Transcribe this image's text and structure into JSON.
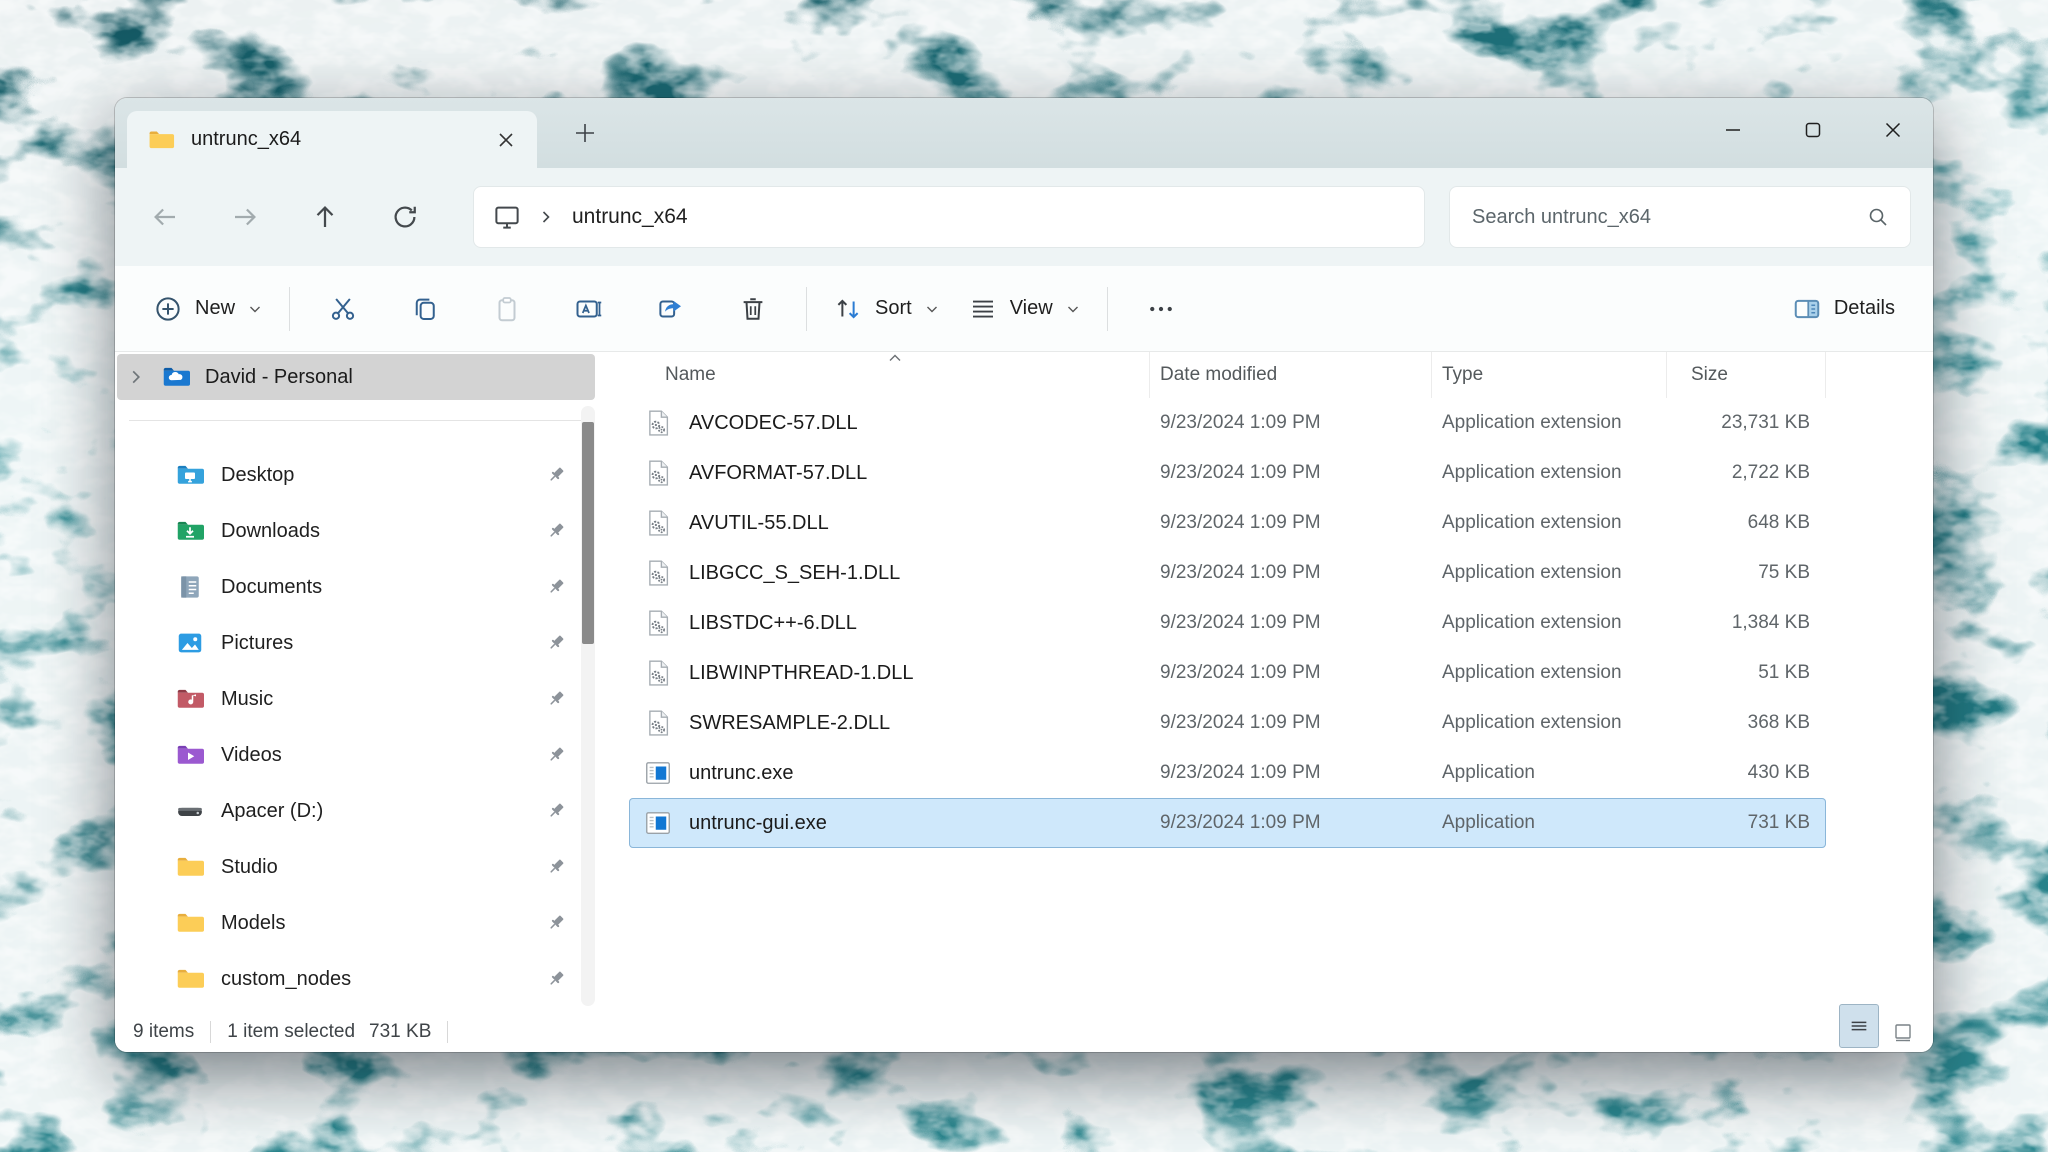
{
  "window": {
    "tab_title": "untrunc_x64",
    "controls": {
      "minimize": "minimize",
      "maximize": "maximize",
      "close": "close"
    }
  },
  "nav": {
    "address": {
      "location": "untrunc_x64"
    },
    "search": {
      "placeholder": "Search untrunc_x64"
    }
  },
  "toolbar": {
    "new_label": "New",
    "sort_label": "Sort",
    "view_label": "View",
    "details_label": "Details"
  },
  "sidebar": {
    "root": {
      "label": "David - Personal",
      "icon": "onedrive-folder"
    },
    "items": [
      {
        "label": "Desktop",
        "icon": "desktop",
        "pinned": true
      },
      {
        "label": "Downloads",
        "icon": "downloads",
        "pinned": true
      },
      {
        "label": "Documents",
        "icon": "documents",
        "pinned": true
      },
      {
        "label": "Pictures",
        "icon": "pictures",
        "pinned": true
      },
      {
        "label": "Music",
        "icon": "music",
        "pinned": true
      },
      {
        "label": "Videos",
        "icon": "videos",
        "pinned": true
      },
      {
        "label": "Apacer (D:)",
        "icon": "drive",
        "pinned": true
      },
      {
        "label": "Studio",
        "icon": "folder",
        "pinned": true
      },
      {
        "label": "Models",
        "icon": "folder",
        "pinned": true
      },
      {
        "label": "custom_nodes",
        "icon": "folder",
        "pinned": true
      }
    ]
  },
  "files": {
    "columns": [
      "Name",
      "Date modified",
      "Type",
      "Size"
    ],
    "sort": {
      "column": "Name",
      "direction": "ascending"
    },
    "rows": [
      {
        "name": "AVCODEC-57.DLL",
        "date": "9/23/2024 1:09 PM",
        "type": "Application extension",
        "size": "23,731 KB",
        "icon": "dll",
        "selected": false
      },
      {
        "name": "AVFORMAT-57.DLL",
        "date": "9/23/2024 1:09 PM",
        "type": "Application extension",
        "size": "2,722 KB",
        "icon": "dll",
        "selected": false
      },
      {
        "name": "AVUTIL-55.DLL",
        "date": "9/23/2024 1:09 PM",
        "type": "Application extension",
        "size": "648 KB",
        "icon": "dll",
        "selected": false
      },
      {
        "name": "LIBGCC_S_SEH-1.DLL",
        "date": "9/23/2024 1:09 PM",
        "type": "Application extension",
        "size": "75 KB",
        "icon": "dll",
        "selected": false
      },
      {
        "name": "LIBSTDC++-6.DLL",
        "date": "9/23/2024 1:09 PM",
        "type": "Application extension",
        "size": "1,384 KB",
        "icon": "dll",
        "selected": false
      },
      {
        "name": "LIBWINPTHREAD-1.DLL",
        "date": "9/23/2024 1:09 PM",
        "type": "Application extension",
        "size": "51 KB",
        "icon": "dll",
        "selected": false
      },
      {
        "name": "SWRESAMPLE-2.DLL",
        "date": "9/23/2024 1:09 PM",
        "type": "Application extension",
        "size": "368 KB",
        "icon": "dll",
        "selected": false
      },
      {
        "name": "untrunc.exe",
        "date": "9/23/2024 1:09 PM",
        "type": "Application",
        "size": "430 KB",
        "icon": "exe",
        "selected": false
      },
      {
        "name": "untrunc-gui.exe",
        "date": "9/23/2024 1:09 PM",
        "type": "Application",
        "size": "731 KB",
        "icon": "exe",
        "selected": true
      }
    ]
  },
  "status": {
    "items_text": "9 items",
    "selected_text": "1 item selected",
    "selected_size": "731 KB"
  },
  "colors": {
    "accent": "#0078d4",
    "selection_bg": "#cfe8fb",
    "selection_border": "#8ab6d9",
    "titlebar": "#d6e1e3",
    "chrome": "#eef4f5",
    "folder_yellow": "#fccd57",
    "ocean_teal": "#2b8c94"
  }
}
